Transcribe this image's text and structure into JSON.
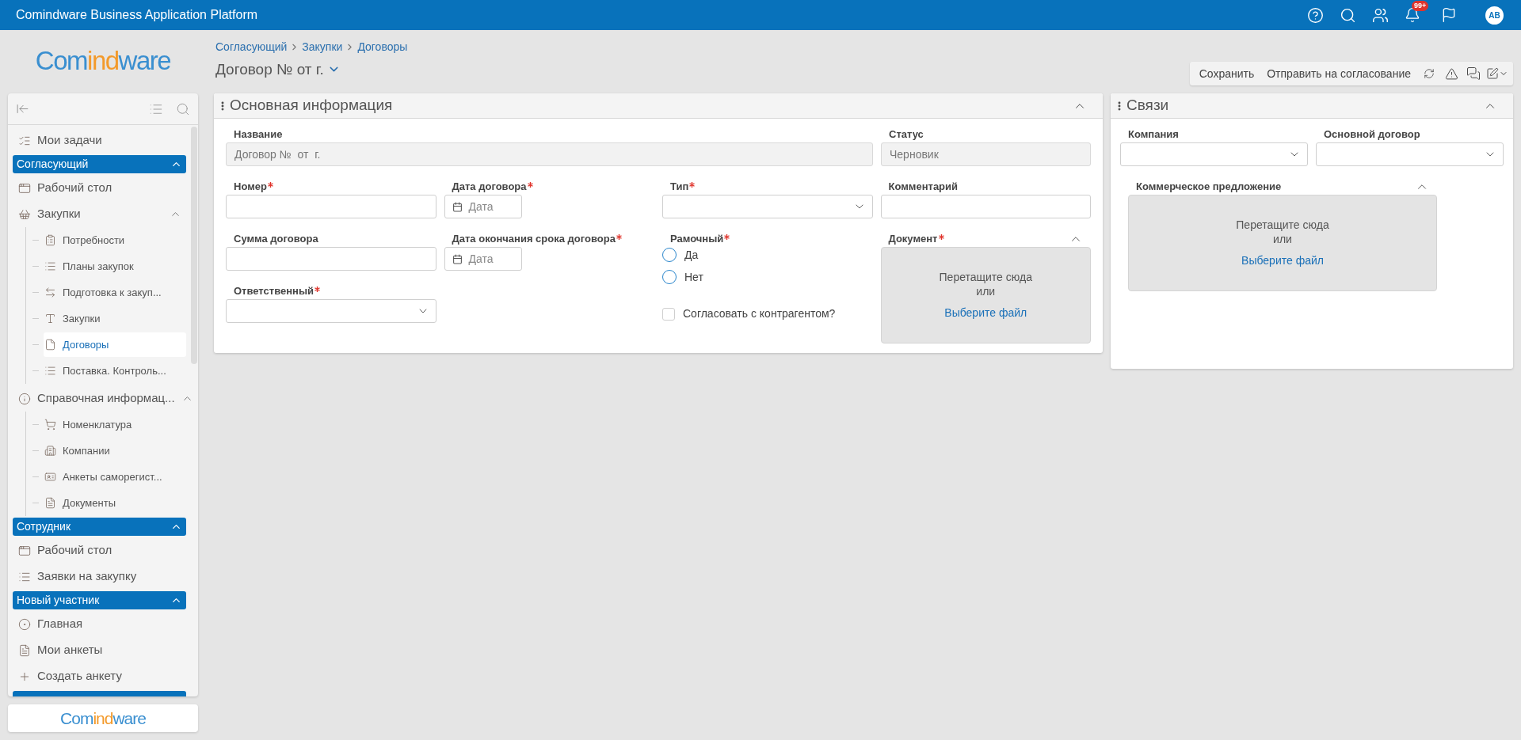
{
  "app_bar": {
    "title": "Comindware Business Application Platform",
    "notification_badge": "99+",
    "avatar": "AB"
  },
  "logo_parts": [
    "Com",
    "ind",
    "ware"
  ],
  "sidebar": {
    "items": [
      {
        "kind": "item",
        "label": "Мои задачи",
        "selected": false
      },
      {
        "kind": "group",
        "label": "Согласующий",
        "expanded": true,
        "children": [
          {
            "kind": "item",
            "label": "Рабочий стол",
            "selected": false
          },
          {
            "kind": "folder",
            "label": "Закупки",
            "expanded": true,
            "children": [
              {
                "kind": "item",
                "label": "Потребности",
                "selected": false
              },
              {
                "kind": "item",
                "label": "Планы закупок",
                "selected": false
              },
              {
                "kind": "item",
                "label": "Подготовка к закуп...",
                "selected": false
              },
              {
                "kind": "item",
                "label": "Закупки",
                "selected": false
              },
              {
                "kind": "item",
                "label": "Договоры",
                "selected": true
              },
              {
                "kind": "item",
                "label": "Поставка. Контроль...",
                "selected": false
              }
            ]
          },
          {
            "kind": "folder",
            "label": "Справочная информац...",
            "expanded": true,
            "children": [
              {
                "kind": "item",
                "label": "Номенклатура",
                "selected": false
              },
              {
                "kind": "item",
                "label": "Компании",
                "selected": false
              },
              {
                "kind": "item",
                "label": "Анкеты саморегист...",
                "selected": false
              },
              {
                "kind": "item",
                "label": "Документы",
                "selected": false
              }
            ]
          }
        ]
      },
      {
        "kind": "group",
        "label": "Сотрудник",
        "expanded": true,
        "children": [
          {
            "kind": "item",
            "label": "Рабочий стол",
            "selected": false
          },
          {
            "kind": "item",
            "label": "Заявки на закупку",
            "selected": false
          }
        ]
      },
      {
        "kind": "group",
        "label": "Новый участник",
        "expanded": true,
        "children": [
          {
            "kind": "item",
            "label": "Главная",
            "selected": false
          },
          {
            "kind": "item",
            "label": "Мои анкеты",
            "selected": false
          },
          {
            "kind": "item",
            "label": "Создать анкету",
            "selected": false
          }
        ]
      }
    ]
  },
  "footer_logo_parts": [
    "Com",
    "ind",
    "ware"
  ],
  "breadcrumb": [
    "Согласующий",
    "Закупки",
    "Договоры"
  ],
  "page_title": "Договор № от г.",
  "toolbar": {
    "buttons": [
      "Сохранить",
      "Отправить на согласование"
    ]
  },
  "main_panel": {
    "title": "Основная информация",
    "expanded": true,
    "top_row": [
      {
        "kind": "readonly",
        "label": "Название",
        "value": "Договор №  от  г.",
        "required": false
      },
      {
        "kind": "readonly",
        "label": "Статус",
        "value": "Черновик",
        "required": false
      }
    ],
    "columns": [
      [
        {
          "kind": "text",
          "label": "Номер",
          "required": true
        },
        {
          "kind": "text",
          "label": "Сумма договора",
          "required": false
        },
        {
          "kind": "select",
          "label": "Ответственный",
          "required": true
        }
      ],
      [
        {
          "kind": "date",
          "label": "Дата договора",
          "placeholder": "Дата",
          "required": true
        },
        {
          "kind": "date",
          "label": "Дата окончания срока договора",
          "placeholder": "Дата",
          "required": true
        }
      ],
      [
        {
          "kind": "select",
          "label": "Тип",
          "required": true
        },
        {
          "kind": "radio",
          "label": "Рамочный",
          "required": true,
          "options": [
            {
              "label": "Да",
              "selected": false
            },
            {
              "label": "Нет",
              "selected": false
            }
          ]
        },
        {
          "kind": "checkbox",
          "label": "Согласовать с контрагентом?",
          "checked": false
        }
      ],
      [
        {
          "kind": "text",
          "label": "Комментарий",
          "required": false
        },
        {
          "kind": "file",
          "label": "Документ",
          "required": true,
          "expanded": true,
          "hint": "Перетащите сюда",
          "or": "или",
          "link": "Выберите файл"
        }
      ]
    ]
  },
  "links_panel": {
    "title": "Связи",
    "expanded": true,
    "fields": [
      {
        "kind": "select",
        "label": "Компания",
        "required": false
      },
      {
        "kind": "select",
        "label": "Основной договор",
        "required": false
      }
    ],
    "file": {
      "label": "Коммерческое предложение",
      "required": false,
      "expanded": true,
      "hint": "Перетащите сюда",
      "or": "или",
      "link": "Выберите файл"
    }
  }
}
